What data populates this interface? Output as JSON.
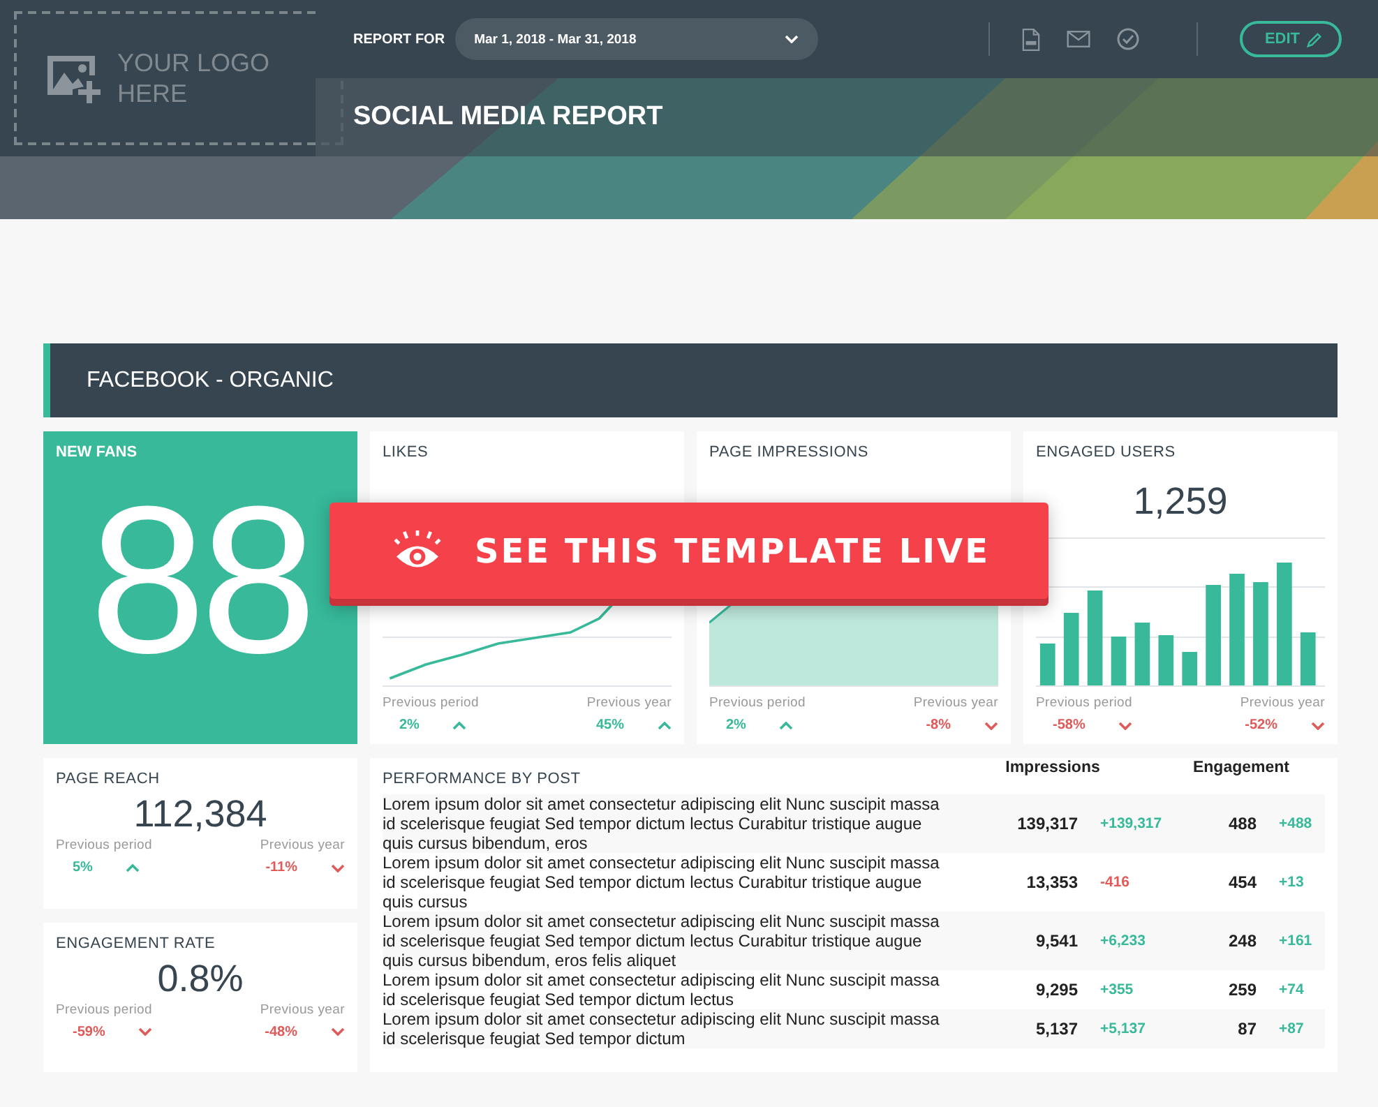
{
  "header": {
    "logo_text": "YOUR LOGO HERE",
    "report_for_label": "REPORT FOR",
    "date_range": "Mar 1, 2018 - Mar 31, 2018",
    "edit_label": "EDIT",
    "title": "SOCIAL MEDIA REPORT"
  },
  "section": {
    "title": "FACEBOOK - ORGANIC"
  },
  "cards": [
    {
      "kind": "hero",
      "title": "NEW FANS",
      "value": "88"
    },
    {
      "kind": "line",
      "title": "LIKES",
      "comparisons": [
        {
          "label": "Previous period",
          "value": "2%",
          "positive": true
        },
        {
          "label": "Previous year",
          "value": "45%",
          "positive": true
        }
      ]
    },
    {
      "kind": "area",
      "title": "PAGE IMPRESSIONS",
      "comparisons": [
        {
          "label": "Previous period",
          "value": "2%",
          "positive": true
        },
        {
          "label": "Previous year",
          "value": "-8%",
          "positive": false
        }
      ]
    },
    {
      "kind": "bar",
      "title": "ENGAGED USERS",
      "value": "1,259",
      "comparisons": [
        {
          "label": "Previous period",
          "value": "-58%",
          "positive": false
        },
        {
          "label": "Previous year",
          "value": "-52%",
          "positive": false
        }
      ]
    }
  ],
  "stats": [
    {
      "title": "PAGE REACH",
      "value": "112,384",
      "comparisons": [
        {
          "label": "Previous period",
          "value": "5%",
          "positive": true
        },
        {
          "label": "Previous year",
          "value": "-11%",
          "positive": false
        }
      ]
    },
    {
      "title": "ENGAGEMENT RATE",
      "value": "0.8%",
      "comparisons": [
        {
          "label": "Previous period",
          "value": "-59%",
          "positive": false
        },
        {
          "label": "Previous year",
          "value": "-48%",
          "positive": false
        }
      ]
    }
  ],
  "table": {
    "title": "PERFORMANCE BY POST",
    "columns": [
      "Impressions",
      "Engagement"
    ],
    "rows": [
      {
        "text": "Lorem ipsum dolor sit amet consectetur adipiscing elit Nunc suscipit massa id scelerisque feugiat Sed tempor dictum lectus Curabitur tristique augue quis cursus bibendum, eros",
        "impressions": "139,317",
        "impressions_change": "+139,317",
        "impressions_positive": true,
        "engagement": "488",
        "engagement_change": "+488",
        "engagement_positive": true
      },
      {
        "text": "Lorem ipsum dolor sit amet consectetur adipiscing elit Nunc suscipit massa id scelerisque feugiat Sed tempor dictum lectus Curabitur tristique augue quis cursus",
        "impressions": "13,353",
        "impressions_change": "-416",
        "impressions_positive": false,
        "engagement": "454",
        "engagement_change": "+13",
        "engagement_positive": true
      },
      {
        "text": "Lorem ipsum dolor sit amet consectetur adipiscing elit Nunc suscipit massa id scelerisque feugiat Sed tempor dictum lectus Curabitur tristique augue quis cursus bibendum, eros felis aliquet",
        "impressions": "9,541",
        "impressions_change": "+6,233",
        "impressions_positive": true,
        "engagement": "248",
        "engagement_change": "+161",
        "engagement_positive": true
      },
      {
        "text": "Lorem ipsum dolor sit amet consectetur adipiscing elit Nunc suscipit massa id scelerisque feugiat Sed tempor dictum lectus",
        "impressions": "9,295",
        "impressions_change": "+355",
        "impressions_positive": true,
        "engagement": "259",
        "engagement_change": "+74",
        "engagement_positive": true
      },
      {
        "text": "Lorem ipsum dolor sit amet consectetur adipiscing elit Nunc suscipit massa id scelerisque feugiat Sed tempor dictum",
        "impressions": "5,137",
        "impressions_change": "+5,137",
        "impressions_positive": true,
        "engagement": "87",
        "engagement_change": "+87",
        "engagement_positive": true
      }
    ]
  },
  "banner": {
    "text": "SEE THIS TEMPLATE LIVE"
  }
}
